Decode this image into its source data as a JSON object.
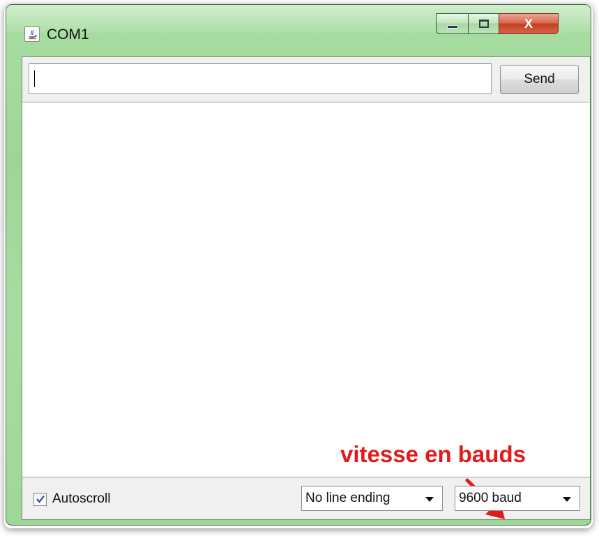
{
  "window": {
    "title": "COM1",
    "icon": "java-cup-icon",
    "controls": {
      "minimize": "minimize-icon",
      "maximize": "maximize-icon",
      "close_label": "X"
    },
    "accent_color": "#a6dca0"
  },
  "input": {
    "value": "",
    "placeholder": ""
  },
  "send_button": {
    "label": "Send"
  },
  "output": {
    "text": ""
  },
  "annotation": {
    "text": "vitesse en bauds",
    "color": "#e11b1b"
  },
  "footer": {
    "autoscroll": {
      "label": "Autoscroll",
      "checked": true
    },
    "line_ending": {
      "selected": "No line ending"
    },
    "baud_rate": {
      "selected": "9600 baud"
    }
  }
}
